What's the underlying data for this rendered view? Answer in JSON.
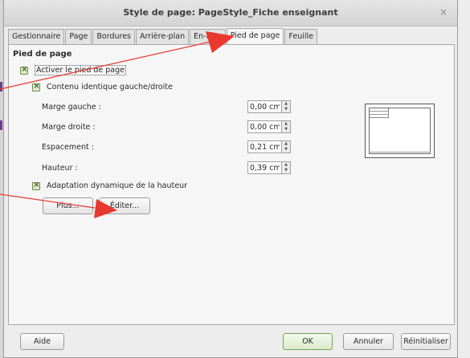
{
  "dialog": {
    "title": "Style de page: PageStyle_Fiche enseignant",
    "close_glyph": "×"
  },
  "tabs": [
    {
      "label": "Gestionnaire",
      "active": false
    },
    {
      "label": "Page",
      "active": false
    },
    {
      "label": "Bordures",
      "active": false
    },
    {
      "label": "Arrière-plan",
      "active": false
    },
    {
      "label": "En-tête",
      "active": false
    },
    {
      "label": "Pied de page",
      "active": true
    },
    {
      "label": "Feuille",
      "active": false
    }
  ],
  "footer_section": {
    "title": "Pied de page",
    "enable_footer": {
      "label": "Activer le pied de page",
      "checked": true
    },
    "same_content": {
      "label": "Contenu identique gauche/droite",
      "checked": true
    },
    "fields": [
      {
        "label": "Marge gauche :",
        "value": "0,00 cm"
      },
      {
        "label": "Marge droite :",
        "value": "0,00 cm"
      },
      {
        "label": "Espacement :",
        "value": "0,21 cm"
      },
      {
        "label": "Hauteur :",
        "value": "0,39 cm"
      }
    ],
    "autofit_height": {
      "label": "Adaptation dynamique de la hauteur",
      "checked": true
    },
    "more_button": "Plus...",
    "edit_button": "Éditer..."
  },
  "bottom_buttons": {
    "help": "Aide",
    "ok": "OK",
    "cancel": "Annuler",
    "reset": "Réinitialiser"
  },
  "annotations": {
    "arrow_color": "#e8382f"
  },
  "icons": {
    "close": "close-icon",
    "checkbox": "checkbox-checked-icon",
    "spin": "spin-up-down-icon"
  }
}
